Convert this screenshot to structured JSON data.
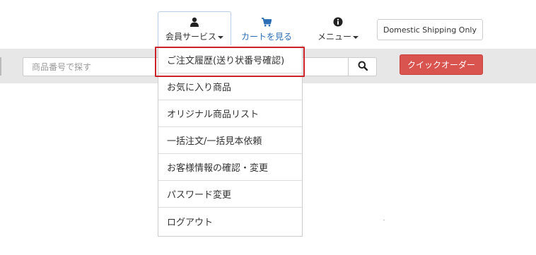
{
  "nav": {
    "member_label": "会員サービス",
    "cart_label": "カートを見る",
    "menu_label": "メニュー",
    "domestic_label": "Domestic Shipping Only"
  },
  "search": {
    "placeholder": "商品番号で探す",
    "quick_order_label": "クイックオーダー"
  },
  "dropdown": {
    "items": [
      {
        "label": "ご注文履歴(送り状番号確認)"
      },
      {
        "label": "お気に入り商品"
      },
      {
        "label": "オリジナル商品リスト"
      },
      {
        "label": "一括注文/一括見本依頼"
      },
      {
        "label": "お客様情報の確認・変更"
      },
      {
        "label": "パスワード変更"
      },
      {
        "label": "ログアウト"
      }
    ]
  },
  "colors": {
    "highlight_border": "#cc2229",
    "cart_blue": "#2a6db5",
    "quick_order_red": "#d9534f",
    "band_gray": "#e7e7e7"
  },
  "icons": {
    "member": "user-icon",
    "cart": "cart-icon",
    "menu": "info-icon",
    "search": "search-icon"
  }
}
